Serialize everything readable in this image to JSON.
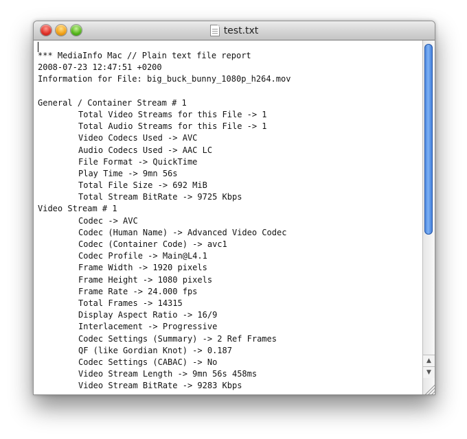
{
  "window": {
    "title": "test.txt"
  },
  "document": {
    "lines": [
      {
        "text": "*** MediaInfo Mac // Plain text file report",
        "indent": false
      },
      {
        "text": "2008-07-23 12:47:51 +0200",
        "indent": false
      },
      {
        "text": "Information for File: big_buck_bunny_1080p_h264.mov",
        "indent": false
      },
      {
        "text": "",
        "indent": false
      },
      {
        "text": "General / Container Stream # 1",
        "indent": false
      },
      {
        "text": "Total Video Streams for this File -> 1",
        "indent": true
      },
      {
        "text": "Total Audio Streams for this File -> 1",
        "indent": true
      },
      {
        "text": "Video Codecs Used -> AVC",
        "indent": true
      },
      {
        "text": "Audio Codecs Used -> AAC LC",
        "indent": true
      },
      {
        "text": "File Format -> QuickTime",
        "indent": true
      },
      {
        "text": "Play Time -> 9mn 56s",
        "indent": true
      },
      {
        "text": "Total File Size -> 692 MiB",
        "indent": true
      },
      {
        "text": "Total Stream BitRate -> 9725 Kbps",
        "indent": true
      },
      {
        "text": "Video Stream # 1",
        "indent": false
      },
      {
        "text": "Codec -> AVC",
        "indent": true
      },
      {
        "text": "Codec (Human Name) -> Advanced Video Codec",
        "indent": true
      },
      {
        "text": "Codec (Container Code) -> avc1",
        "indent": true
      },
      {
        "text": "Codec Profile -> Main@L4.1",
        "indent": true
      },
      {
        "text": "Frame Width -> 1920 pixels",
        "indent": true
      },
      {
        "text": "Frame Height -> 1080 pixels",
        "indent": true
      },
      {
        "text": "Frame Rate -> 24.000 fps",
        "indent": true
      },
      {
        "text": "Total Frames -> 14315",
        "indent": true
      },
      {
        "text": "Display Aspect Ratio -> 16/9",
        "indent": true
      },
      {
        "text": "Interlacement -> Progressive",
        "indent": true
      },
      {
        "text": "Codec Settings (Summary) -> 2 Ref Frames",
        "indent": true
      },
      {
        "text": "QF (like Gordian Knot) -> 0.187",
        "indent": true
      },
      {
        "text": "Codec Settings (CABAC) -> No",
        "indent": true
      },
      {
        "text": "Video Stream Length -> 9mn 56s 458ms",
        "indent": true
      },
      {
        "text": "Video Stream BitRate -> 9283 Kbps",
        "indent": true
      }
    ]
  },
  "scrollbar": {
    "position_fraction": 0.0,
    "up_icon": "arrow-up-icon",
    "down_icon": "arrow-down-icon"
  },
  "colors": {
    "close": "#e0322a",
    "minimize": "#f2a31a",
    "zoom": "#58b81d",
    "scroll_thumb": "#5a95e6"
  }
}
